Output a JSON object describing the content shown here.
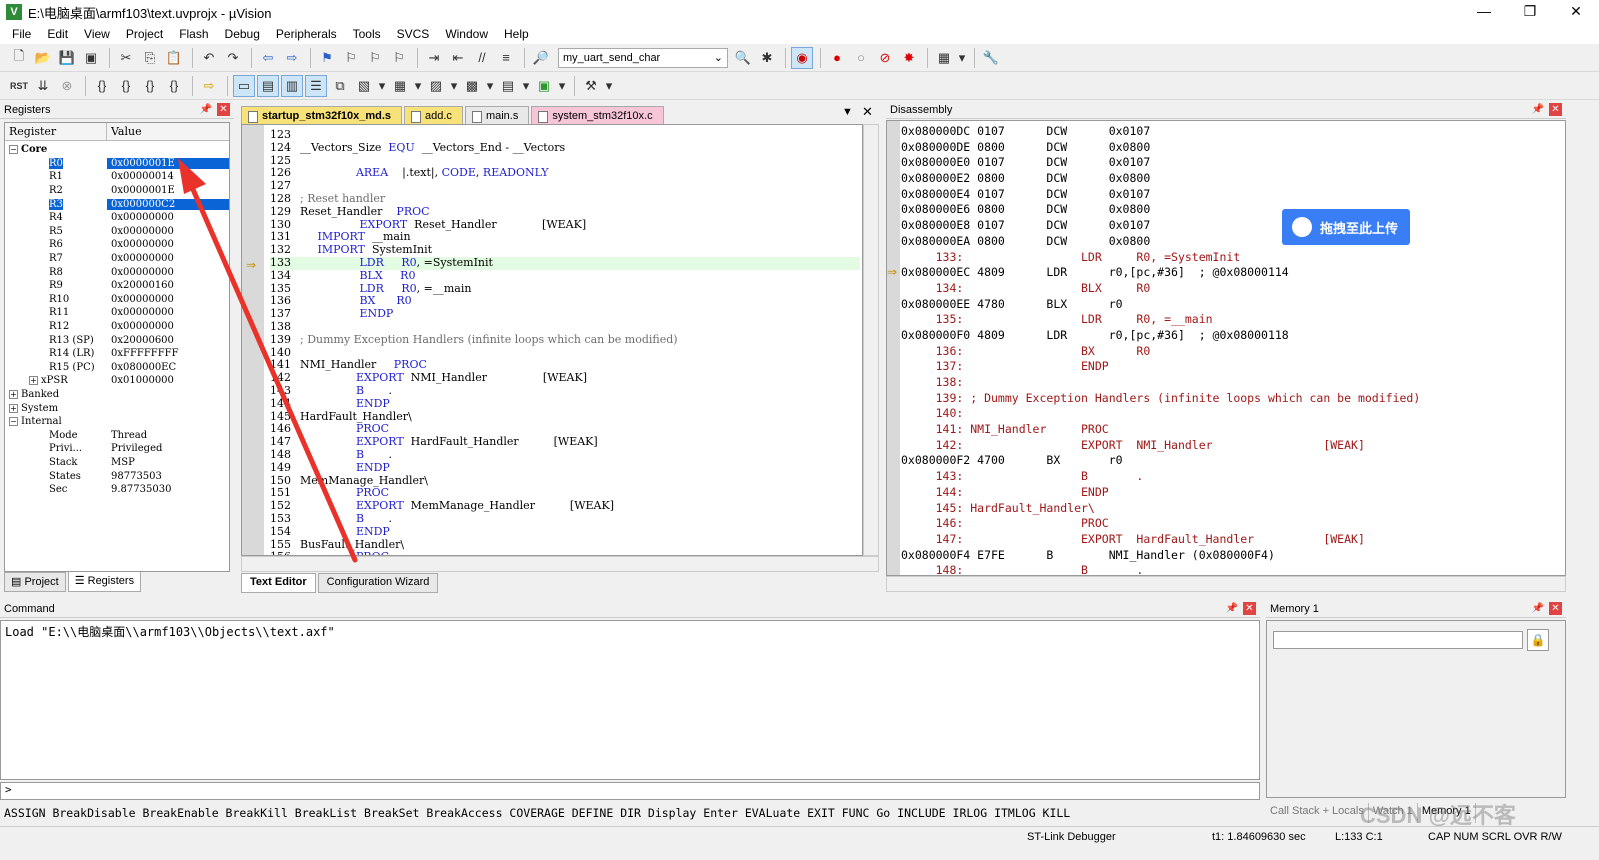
{
  "window": {
    "title": "E:\\电脑桌面\\armf103\\text.uvprojx - µVision",
    "buttons": [
      "—",
      "❐",
      "✕"
    ]
  },
  "menu": [
    "File",
    "Edit",
    "View",
    "Project",
    "Flash",
    "Debug",
    "Peripherals",
    "Tools",
    "SVCS",
    "Window",
    "Help"
  ],
  "toolbar": {
    "target_function": "my_uart_send_char"
  },
  "registers_panel": {
    "title": "Registers",
    "col_register": "Register",
    "col_value": "Value",
    "core_label": "Core",
    "core": [
      {
        "name": "R0",
        "value": "0x0000001E",
        "selected": true
      },
      {
        "name": "R1",
        "value": "0x00000014"
      },
      {
        "name": "R2",
        "value": "0x0000001E"
      },
      {
        "name": "R3",
        "value": "0x000000C2",
        "selected": true
      },
      {
        "name": "R4",
        "value": "0x00000000"
      },
      {
        "name": "R5",
        "value": "0x00000000"
      },
      {
        "name": "R6",
        "value": "0x00000000"
      },
      {
        "name": "R7",
        "value": "0x00000000"
      },
      {
        "name": "R8",
        "value": "0x00000000"
      },
      {
        "name": "R9",
        "value": "0x20000160"
      },
      {
        "name": "R10",
        "value": "0x00000000"
      },
      {
        "name": "R11",
        "value": "0x00000000"
      },
      {
        "name": "R12",
        "value": "0x00000000"
      },
      {
        "name": "R13 (SP)",
        "value": "0x20000600"
      },
      {
        "name": "R14 (LR)",
        "value": "0xFFFFFFFF"
      },
      {
        "name": "R15 (PC)",
        "value": "0x080000EC"
      },
      {
        "name": "xPSR",
        "value": "0x01000000"
      }
    ],
    "groups": [
      "Banked",
      "System",
      "Internal"
    ],
    "internal": [
      {
        "name": "Mode",
        "value": "Thread"
      },
      {
        "name": "Privi...",
        "value": "Privileged"
      },
      {
        "name": "Stack",
        "value": "MSP"
      },
      {
        "name": "States",
        "value": "98773503"
      },
      {
        "name": "Sec",
        "value": "9.87735030"
      }
    ],
    "tabs": [
      "Project",
      "Registers"
    ]
  },
  "editor": {
    "tabs": [
      {
        "label": "startup_stm32f10x_md.s",
        "color": "#f7e27a"
      },
      {
        "label": "add.c",
        "color": "#f7e27a"
      },
      {
        "label": "main.s",
        "color": "#e8e8e8"
      },
      {
        "label": "system_stm32f10x.c",
        "color": "#f6c6d8"
      }
    ],
    "lines": [
      {
        "n": "123",
        "t": ""
      },
      {
        "n": "124",
        "t": "__Vectors_Size  EQU  __Vectors_End - __Vectors"
      },
      {
        "n": "125",
        "t": ""
      },
      {
        "n": "126",
        "t": "                AREA    |.text|, CODE, READONLY"
      },
      {
        "n": "127",
        "t": ""
      },
      {
        "n": "128",
        "t": "; Reset handler",
        "c": true
      },
      {
        "n": "129",
        "t": "Reset_Handler    PROC"
      },
      {
        "n": "130",
        "t": "                 EXPORT  Reset_Handler             [WEAK]"
      },
      {
        "n": "131",
        "t": "     IMPORT  __main"
      },
      {
        "n": "132",
        "t": "     IMPORT  SystemInit"
      },
      {
        "n": "133",
        "t": "                 LDR     R0, =SystemInit",
        "cur": true
      },
      {
        "n": "134",
        "t": "                 BLX     R0"
      },
      {
        "n": "135",
        "t": "                 LDR     R0, =__main"
      },
      {
        "n": "136",
        "t": "                 BX      R0"
      },
      {
        "n": "137",
        "t": "                 ENDP"
      },
      {
        "n": "138",
        "t": ""
      },
      {
        "n": "139",
        "t": "; Dummy Exception Handlers (infinite loops which can be modified)",
        "c": true
      },
      {
        "n": "140",
        "t": ""
      },
      {
        "n": "141",
        "t": "NMI_Handler     PROC"
      },
      {
        "n": "142",
        "t": "                EXPORT  NMI_Handler                [WEAK]"
      },
      {
        "n": "143",
        "t": "                B       ."
      },
      {
        "n": "144",
        "t": "                ENDP"
      },
      {
        "n": "145",
        "t": "HardFault_Handler\\"
      },
      {
        "n": "146",
        "t": "                PROC"
      },
      {
        "n": "147",
        "t": "                EXPORT  HardFault_Handler          [WEAK]"
      },
      {
        "n": "148",
        "t": "                B       ."
      },
      {
        "n": "149",
        "t": "                ENDP"
      },
      {
        "n": "150",
        "t": "MemManage_Handler\\"
      },
      {
        "n": "151",
        "t": "                PROC"
      },
      {
        "n": "152",
        "t": "                EXPORT  MemManage_Handler          [WEAK]"
      },
      {
        "n": "153",
        "t": "                B       ."
      },
      {
        "n": "154",
        "t": "                ENDP"
      },
      {
        "n": "155",
        "t": "BusFault_Handler\\"
      },
      {
        "n": "156",
        "t": "                PROC"
      }
    ],
    "bottom_tabs": [
      "Text Editor",
      "Configuration Wizard"
    ]
  },
  "disassembly": {
    "title": "Disassembly",
    "lines": [
      {
        "t": "0x080000DC 0107      DCW      0x0107"
      },
      {
        "t": "0x080000DE 0800      DCW      0x0800"
      },
      {
        "t": "0x080000E0 0107      DCW      0x0107"
      },
      {
        "t": "0x080000E2 0800      DCW      0x0800"
      },
      {
        "t": "0x080000E4 0107      DCW      0x0107"
      },
      {
        "t": "0x080000E6 0800      DCW      0x0800"
      },
      {
        "t": "0x080000E8 0107      DCW      0x0107"
      },
      {
        "t": "0x080000EA 0800      DCW      0x0800"
      },
      {
        "t": "     133:                 LDR     R0, =SystemInit",
        "src": true
      },
      {
        "t": "0x080000EC 4809      LDR      r0,[pc,#36]  ; @0x08000114",
        "cur": true
      },
      {
        "t": "     134:                 BLX     R0",
        "src": true
      },
      {
        "t": "0x080000EE 4780      BLX      r0"
      },
      {
        "t": "     135:                 LDR     R0, =__main",
        "src": true
      },
      {
        "t": "0x080000F0 4809      LDR      r0,[pc,#36]  ; @0x08000118"
      },
      {
        "t": "     136:                 BX      R0",
        "src": true
      },
      {
        "t": "     137:                 ENDP",
        "src": true
      },
      {
        "t": "     138: ",
        "src": true
      },
      {
        "t": "     139: ; Dummy Exception Handlers (infinite loops which can be modified)",
        "src": true
      },
      {
        "t": "     140: ",
        "src": true
      },
      {
        "t": "     141: NMI_Handler     PROC",
        "src": true
      },
      {
        "t": "     142:                 EXPORT  NMI_Handler                [WEAK]",
        "src": true
      },
      {
        "t": "0x080000F2 4700      BX       r0"
      },
      {
        "t": "     143:                 B       .",
        "src": true
      },
      {
        "t": "     144:                 ENDP",
        "src": true
      },
      {
        "t": "     145: HardFault_Handler\\",
        "src": true
      },
      {
        "t": "     146:                 PROC",
        "src": true
      },
      {
        "t": "     147:                 EXPORT  HardFault_Handler          [WEAK]",
        "src": true
      },
      {
        "t": "0x080000F4 E7FE      B        NMI_Handler (0x080000F4)"
      },
      {
        "t": "     148:                 B       .",
        "src": true
      }
    ]
  },
  "upload_badge": "拖拽至此上传",
  "command": {
    "title": "Command",
    "output": "Load \"E:\\\\电脑桌面\\\\armf103\\\\Objects\\\\text.axf\"",
    "prompt": ">",
    "help": "ASSIGN BreakDisable BreakEnable BreakKill BreakList BreakSet BreakAccess COVERAGE DEFINE DIR Display Enter EVALuate EXIT FUNC Go INCLUDE IRLOG ITMLOG KILL"
  },
  "memory": {
    "title": "Memory 1",
    "tabs": [
      "Call Stack + Locals",
      "Watch 1",
      "Memory 1"
    ]
  },
  "status": {
    "debugger": "ST-Link Debugger",
    "time": "t1: 1.84609630 sec",
    "position": "L:133 C:1",
    "indicators": "CAP  NUM  SCRL  OVR  R/W"
  },
  "watermark": "CSDN @远不客"
}
